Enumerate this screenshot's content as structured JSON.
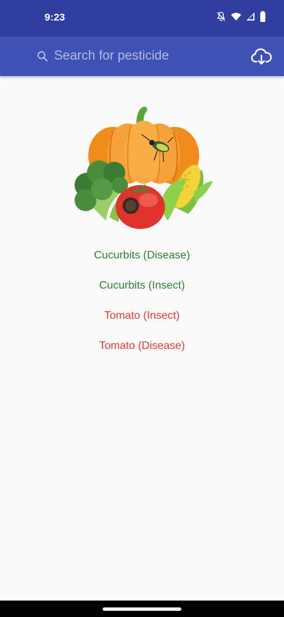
{
  "status_bar": {
    "time": "9:23",
    "icons": [
      "mute-icon",
      "wifi-icon",
      "signal-icon",
      "battery-icon"
    ]
  },
  "app_bar": {
    "search_placeholder": "Search for pesticide",
    "search_value": "",
    "search_icon": "search-icon",
    "action_icon": "cloud-download-icon",
    "color": "#3f51b5"
  },
  "hero": {
    "image": "vegetables-illustration"
  },
  "crops": [
    {
      "label": "Cucurbits (Disease)",
      "color": "#2e7d32"
    },
    {
      "label": "Cucurbits (Insect)",
      "color": "#2e7d32"
    },
    {
      "label": "Tomato (Insect)",
      "color": "#e53935"
    },
    {
      "label": "Tomato (Disease)",
      "color": "#e53935"
    }
  ],
  "colors": {
    "status_bar": "#303f9f",
    "app_bar": "#3f51b5",
    "background": "#fafafa"
  }
}
